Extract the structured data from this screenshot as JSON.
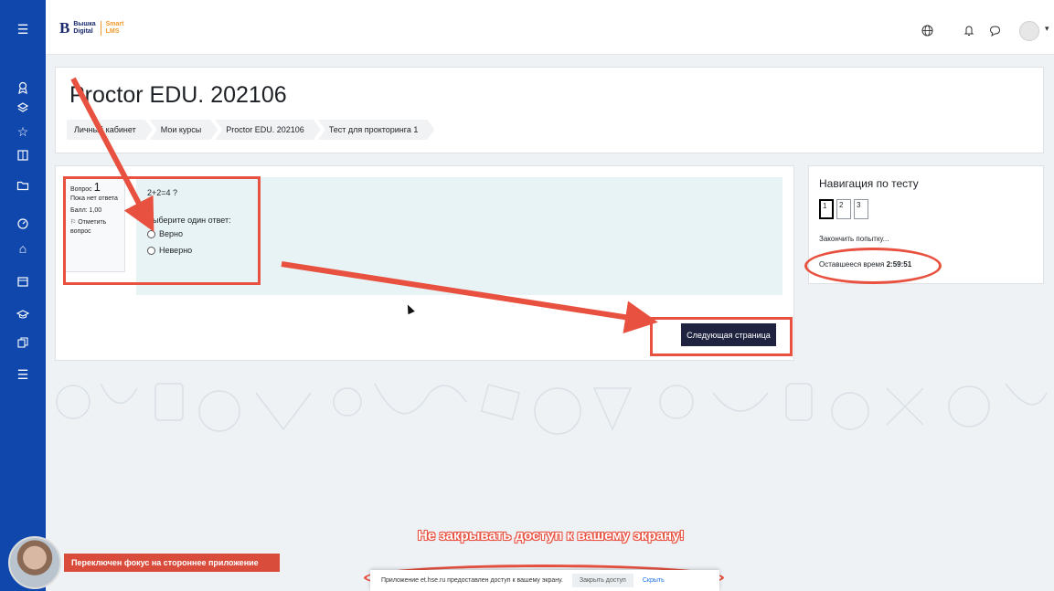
{
  "sidebar": {
    "icons": [
      "menu-icon",
      "badge-icon",
      "layers-icon",
      "star-icon",
      "book-icon",
      "folder-icon",
      "dashboard-icon",
      "home-icon",
      "calendar-icon",
      "graduation-icon",
      "copy-icon",
      "list-icon"
    ]
  },
  "topbar": {
    "logo_mark": "B",
    "logo_line1": "Вышка",
    "logo_line2": "Digital",
    "logo_smart": "Smart",
    "logo_lms": "LMS"
  },
  "course": {
    "title": "Proctor EDU. 202106",
    "breadcrumb": [
      "Личный кабинет",
      "Мои курсы",
      "Proctor EDU. 202106",
      "Тест для прокторинга 1"
    ]
  },
  "question": {
    "label": "Вопрос",
    "number": "1",
    "status": "Пока нет ответа",
    "score": "Балл: 1,00",
    "flag": "Отметить вопрос",
    "text": "2+2=4 ?",
    "prompt": "Выберите один ответ:",
    "options": [
      "Верно",
      "Неверно"
    ]
  },
  "next_button": "Следующая страница",
  "navigation": {
    "title": "Навигация по тесту",
    "pages": [
      "1",
      "2",
      "3"
    ],
    "finish": "Закончить попытку...",
    "time_label": "Оставшееся время",
    "time_value": "2:59:51"
  },
  "overlay": {
    "warning": "Не закрывать доступ к вашему экрану!",
    "share_text": "Приложение et.hse.ru предоставлен доступ к вашему экрану.",
    "stop_sharing": "Закрыть доступ",
    "hide": "Скрыть",
    "focus_message": "Переключен фокус на стороннее приложение"
  },
  "colors": {
    "sidebar": "#0f47ad",
    "annotation": "#e8513f",
    "button": "#1f2340"
  }
}
